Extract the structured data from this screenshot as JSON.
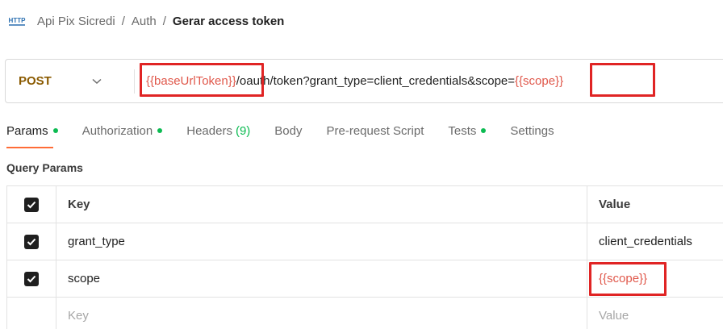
{
  "breadcrumb": {
    "icon": "http-icon",
    "icon_text": "HTTP",
    "items": [
      "Api Pix Sicredi",
      "Auth"
    ],
    "current": "Gerar access token"
  },
  "request": {
    "method": "POST",
    "url_parts": [
      {
        "text": "{{baseUrlToken}}",
        "type": "variable"
      },
      {
        "text": "/oauth/token?grant_type=client_credentials&scope=",
        "type": "plain"
      },
      {
        "text": "{{scope}}",
        "type": "variable"
      }
    ]
  },
  "tabs": [
    {
      "label": "Params",
      "dot": true,
      "active": true
    },
    {
      "label": "Authorization",
      "dot": true
    },
    {
      "label": "Headers",
      "count": "(9)"
    },
    {
      "label": "Body"
    },
    {
      "label": "Pre-request Script"
    },
    {
      "label": "Tests",
      "dot": true
    },
    {
      "label": "Settings"
    }
  ],
  "params": {
    "title": "Query Params",
    "header": {
      "key": "Key",
      "value": "Value"
    },
    "rows": [
      {
        "checked": true,
        "key": "grant_type",
        "value": "client_credentials",
        "value_type": "plain"
      },
      {
        "checked": true,
        "key": "scope",
        "value": "{{scope}}",
        "value_type": "variable"
      }
    ],
    "empty_row": {
      "key_placeholder": "Key",
      "value_placeholder": "Value"
    }
  },
  "colors": {
    "variable": "#e0584b",
    "highlight_box": "#e02424",
    "active_dot": "#0cbb52",
    "tab_underline": "#ff6c37",
    "method": "#8a5a00"
  }
}
